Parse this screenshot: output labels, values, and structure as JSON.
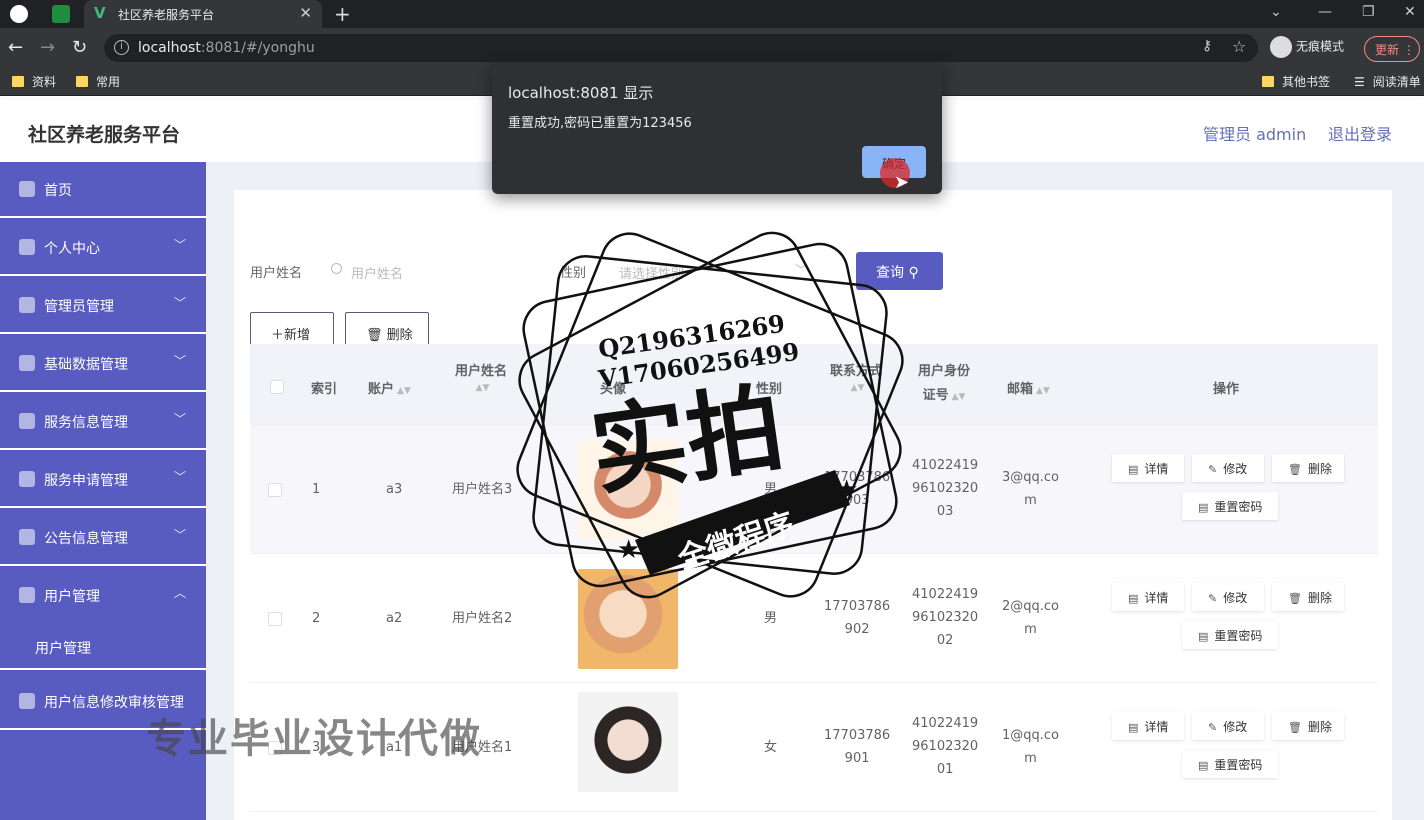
{
  "browser": {
    "tab_title": "社区养老服务平台",
    "url_host": "localhost",
    "url_rest": ":8081/#/yonghu",
    "incognito_label": "无痕模式",
    "update_label": "更新",
    "bookmarks": [
      "资料",
      "常用"
    ],
    "bookmarks_right": [
      "其他书签",
      "阅读清单"
    ]
  },
  "header": {
    "title": "社区养老服务平台",
    "user": "管理员 admin",
    "logout": "退出登录"
  },
  "sidebar": {
    "items": [
      {
        "label": "首页",
        "icon": "home-icon"
      },
      {
        "label": "个人中心",
        "icon": "user-icon"
      },
      {
        "label": "管理员管理",
        "icon": "compass-icon"
      },
      {
        "label": "基础数据管理",
        "icon": "list-icon"
      },
      {
        "label": "服务信息管理",
        "icon": "compass-icon"
      },
      {
        "label": "服务申请管理",
        "icon": "chat-icon"
      },
      {
        "label": "公告信息管理",
        "icon": "globe-icon"
      },
      {
        "label": "用户管理",
        "icon": "chart-icon"
      },
      {
        "label": "用户信息修改审核管理",
        "icon": "flag-icon"
      }
    ],
    "sub_item": "用户管理"
  },
  "search": {
    "name_label": "用户姓名",
    "name_placeholder": "用户姓名",
    "gender_label": "性别",
    "gender_placeholder": "请选择性别",
    "query_label": "查询"
  },
  "actions": {
    "add_label": "新增",
    "delete_label": "删除"
  },
  "table": {
    "headers": {
      "index": "索引",
      "account": "账户",
      "name": "用户姓名",
      "avatar": "头像",
      "gender": "性别",
      "contact": "联系方式",
      "idcard_1": "用户身份",
      "idcard_2": "证号",
      "email": "邮箱",
      "ops": "操作"
    },
    "rows": [
      {
        "index": "1",
        "account": "a3",
        "name": "用户姓名3",
        "gender": "男",
        "phone_1": "17703786",
        "phone_2": "903",
        "id_1": "41022419",
        "id_2": "96102320",
        "id_3": "03",
        "email_1": "3@qq.co",
        "email_2": "m"
      },
      {
        "index": "2",
        "account": "a2",
        "name": "用户姓名2",
        "gender": "男",
        "phone_1": "17703786",
        "phone_2": "902",
        "id_1": "41022419",
        "id_2": "96102320",
        "id_3": "02",
        "email_1": "2@qq.co",
        "email_2": "m"
      },
      {
        "index": "3",
        "account": "a1",
        "name": "用户姓名1",
        "gender": "女",
        "phone_1": "17703786",
        "phone_2": "901",
        "id_1": "41022419",
        "id_2": "96102320",
        "id_3": "01",
        "email_1": "1@qq.co",
        "email_2": "m"
      }
    ],
    "op_labels": {
      "detail": "详情",
      "edit": "修改",
      "delete": "删除",
      "reset": "重置密码"
    }
  },
  "dialog": {
    "title": "localhost:8081 显示",
    "message": "重置成功,密码已重置为123456",
    "ok": "确定"
  },
  "watermark": {
    "contact_1": "Q2196316269",
    "contact_2": "V17060256499",
    "seal_main": "实拍",
    "seal_banner": "全微程序",
    "bottom_text": "专业毕业设计代做"
  }
}
